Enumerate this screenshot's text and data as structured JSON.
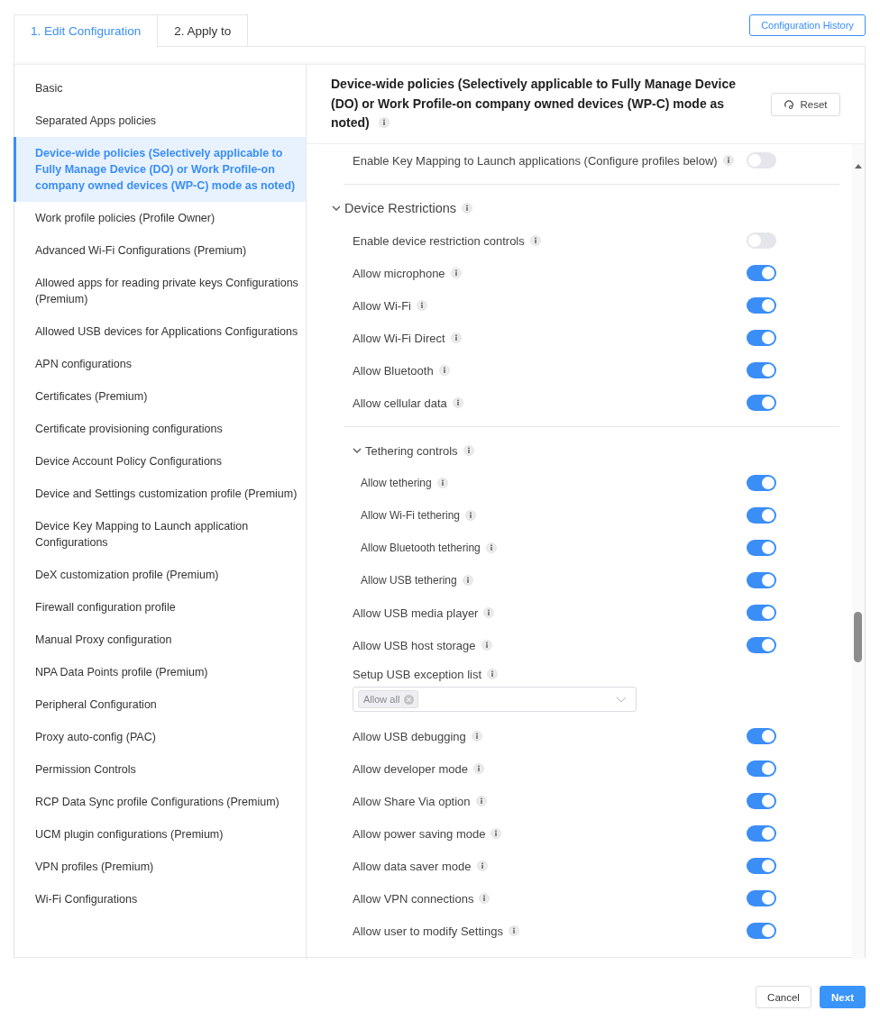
{
  "tabs": [
    {
      "label": "1. Edit Configuration",
      "selected": true
    },
    {
      "label": "2. Apply to",
      "selected": false
    }
  ],
  "history_button": "Configuration History",
  "sidebar": {
    "items": [
      {
        "label": "Basic",
        "selected": false
      },
      {
        "label": "Separated Apps policies",
        "selected": false
      },
      {
        "label": "Device-wide policies (Selectively applicable to Fully Manage Device (DO) or Work Profile-on company owned devices (WP-C) mode as noted)",
        "selected": true
      },
      {
        "label": "Work profile policies (Profile Owner)",
        "selected": false
      },
      {
        "label": "Advanced Wi-Fi Configurations (Premium)",
        "selected": false
      },
      {
        "label": "Allowed apps for reading private keys Configurations (Premium)",
        "selected": false
      },
      {
        "label": "Allowed USB devices for Applications Configurations",
        "selected": false
      },
      {
        "label": "APN configurations",
        "selected": false
      },
      {
        "label": "Certificates (Premium)",
        "selected": false
      },
      {
        "label": "Certificate provisioning configurations",
        "selected": false
      },
      {
        "label": "Device Account Policy Configurations",
        "selected": false
      },
      {
        "label": "Device and Settings customization profile (Premium)",
        "selected": false
      },
      {
        "label": "Device Key Mapping to Launch application Configurations",
        "selected": false
      },
      {
        "label": "DeX customization profile (Premium)",
        "selected": false
      },
      {
        "label": "Firewall configuration profile",
        "selected": false
      },
      {
        "label": "Manual Proxy configuration",
        "selected": false
      },
      {
        "label": "NPA Data Points profile (Premium)",
        "selected": false
      },
      {
        "label": "Peripheral Configuration",
        "selected": false
      },
      {
        "label": "Proxy auto-config (PAC)",
        "selected": false
      },
      {
        "label": "Permission Controls",
        "selected": false
      },
      {
        "label": "RCP Data Sync profile Configurations (Premium)",
        "selected": false
      },
      {
        "label": "UCM plugin configurations (Premium)",
        "selected": false
      },
      {
        "label": "VPN profiles (Premium)",
        "selected": false
      },
      {
        "label": "Wi-Fi Configurations",
        "selected": false
      }
    ]
  },
  "panel": {
    "title": "Device-wide policies (Selectively applicable to Fully Manage Device (DO) or Work Profile-on company owned devices (WP-C) mode as noted)",
    "reset_button": "Reset",
    "settings": [
      {
        "kind": "toggle",
        "label": "Enable Key Mapping to Launch applications (Configure profiles below)",
        "on": false
      },
      {
        "kind": "group",
        "label": "Device Restrictions",
        "expanded": true,
        "children": [
          {
            "kind": "toggle",
            "label": "Enable device restriction controls",
            "on": false
          },
          {
            "kind": "toggle",
            "label": "Allow microphone",
            "on": true
          },
          {
            "kind": "toggle",
            "label": "Allow Wi-Fi",
            "on": true
          },
          {
            "kind": "toggle",
            "label": "Allow Wi-Fi Direct",
            "on": true
          },
          {
            "kind": "toggle",
            "label": "Allow Bluetooth",
            "on": true
          },
          {
            "kind": "toggle",
            "label": "Allow cellular data",
            "on": true
          },
          {
            "kind": "group",
            "label": "Tethering controls",
            "expanded": true,
            "children": [
              {
                "kind": "toggle",
                "label": "Allow tethering",
                "on": true
              },
              {
                "kind": "toggle",
                "label": "Allow Wi-Fi tethering",
                "on": true
              },
              {
                "kind": "toggle",
                "label": "Allow Bluetooth tethering",
                "on": true
              },
              {
                "kind": "toggle",
                "label": "Allow USB tethering",
                "on": true
              }
            ]
          },
          {
            "kind": "toggle",
            "label": "Allow USB media player",
            "on": true
          },
          {
            "kind": "toggle",
            "label": "Allow USB host storage",
            "on": true
          },
          {
            "kind": "select",
            "label": "Setup USB exception list",
            "tags": [
              "Allow all"
            ]
          },
          {
            "kind": "toggle",
            "label": "Allow USB debugging",
            "on": true
          },
          {
            "kind": "toggle",
            "label": "Allow developer mode",
            "on": true
          },
          {
            "kind": "toggle",
            "label": "Allow Share Via option",
            "on": true
          },
          {
            "kind": "toggle",
            "label": "Allow power saving mode",
            "on": true
          },
          {
            "kind": "toggle",
            "label": "Allow data saver mode",
            "on": true
          },
          {
            "kind": "toggle",
            "label": "Allow VPN connections",
            "on": true
          },
          {
            "kind": "toggle",
            "label": "Allow user to modify Settings",
            "on": true
          }
        ]
      }
    ]
  },
  "footer": {
    "buttons": [
      {
        "label": "Cancel",
        "kind": "secondary"
      },
      {
        "label": "Next",
        "kind": "primary"
      }
    ]
  }
}
